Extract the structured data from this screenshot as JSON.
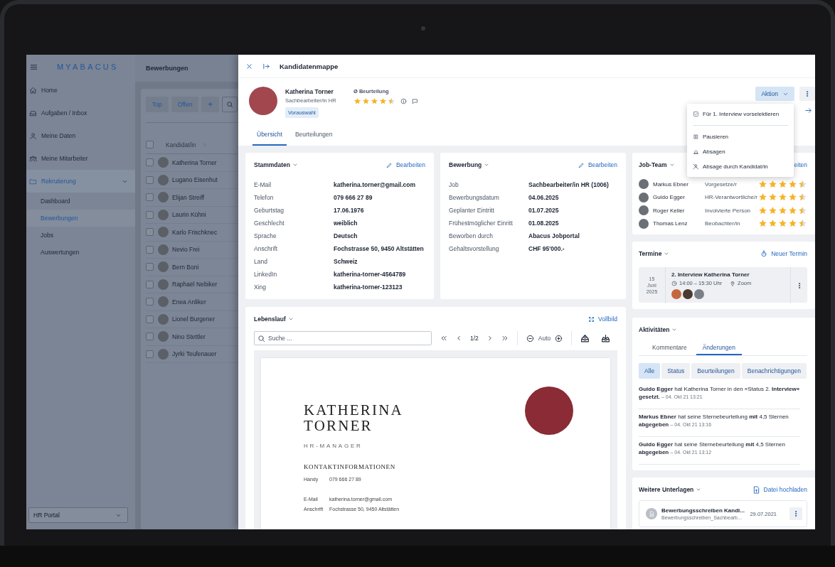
{
  "sidebar": {
    "logo": "MYABACUS",
    "items": [
      {
        "label": "Home",
        "selected": false
      },
      {
        "label": "Aufgaben / Inbox",
        "selected": false
      },
      {
        "label": "Meine Daten",
        "selected": false
      },
      {
        "label": "Meine Mitarbeiter",
        "selected": false
      },
      {
        "label": "Rekrutierung",
        "selected": true,
        "expanded": true,
        "children": [
          {
            "label": "Dashboard",
            "selected": false
          },
          {
            "label": "Bewerbungen",
            "selected": true
          },
          {
            "label": "Jobs",
            "selected": false
          },
          {
            "label": "Auswertungen",
            "selected": false
          }
        ]
      }
    ],
    "portal": {
      "value": "HR Portal"
    }
  },
  "list": {
    "title": "Bewerbungen",
    "filters": [
      "Top",
      "Offen"
    ],
    "add": "+",
    "column": "Kandidat/in",
    "select_all": {
      "checked": false
    },
    "rows": [
      {
        "name": "Katherina Torner",
        "checked": false
      },
      {
        "name": "Lugano Eisenhut",
        "checked": false
      },
      {
        "name": "Elijan Streiff",
        "checked": false
      },
      {
        "name": "Laurin Kühni",
        "checked": false
      },
      {
        "name": "Karlo Frischknec",
        "checked": false
      },
      {
        "name": "Nevio Frei",
        "checked": false
      },
      {
        "name": "Bern Boni",
        "checked": false
      },
      {
        "name": "Raphaël Nebiker",
        "checked": false
      },
      {
        "name": "Enea Anliker",
        "checked": false
      },
      {
        "name": "Lionel Burgener",
        "checked": false
      },
      {
        "name": "Nino Stettler",
        "checked": false
      },
      {
        "name": "Jyrki Teufenauer",
        "checked": false
      }
    ]
  },
  "drawer": {
    "title": "Kandidatenmappe",
    "candidate": {
      "name": "Katherina Torner",
      "role": "Sachbearbeiter/in HR",
      "status": "Vorauswahl",
      "rating_label": "Ø Beurteilung",
      "stars": 4.5
    },
    "action_button": "Aktion",
    "menu": [
      {
        "items": [
          "Für 1. Interview vorselektieren"
        ]
      },
      {
        "items": [
          "Pausieren",
          "Absagen",
          "Absage durch Kandidat/in"
        ]
      }
    ],
    "tabs": [
      {
        "label": "Übersicht",
        "selected": true
      },
      {
        "label": "Beurteilungen",
        "selected": false
      }
    ],
    "stammdaten": {
      "title": "Stammdaten",
      "action": "Bearbeiten",
      "fields": [
        {
          "label": "E-Mail",
          "value": "katherina.torner@gmail.com"
        },
        {
          "label": "Telefon",
          "value": "079 666 27 89"
        },
        {
          "label": "Geburtstag",
          "value": "17.06.1976"
        },
        {
          "label": "Geschlecht",
          "value": "weiblich"
        },
        {
          "label": "Sprache",
          "value": "Deutsch"
        },
        {
          "label": "Anschrift",
          "value": "Fochstrasse 50, 9450 Altstätten"
        },
        {
          "label": "Land",
          "value": "Schweiz"
        },
        {
          "label": "LinkedIn",
          "value": "katherina-torner-4564789"
        },
        {
          "label": "Xing",
          "value": "katherina-torner-123123"
        }
      ]
    },
    "bewerbung": {
      "title": "Bewerbung",
      "action": "Bearbeiten",
      "fields": [
        {
          "label": "Job",
          "value": "Sachbearbeiter/in HR (1006)"
        },
        {
          "label": "Bewerbungsdatum",
          "value": "04.06.2025"
        },
        {
          "label": "Geplanter Eintritt",
          "value": "01.07.2025"
        },
        {
          "label": "Frühestmöglicher Einritt",
          "value": "01.08.2025"
        },
        {
          "label": "Beworben durch",
          "value": "Abacus Jobportal"
        },
        {
          "label": "Gehaltsvorstellung",
          "value": "CHF 95'000.-"
        }
      ]
    },
    "lebenslauf": {
      "title": "Lebenslauf",
      "action": "Vollbild",
      "search": {
        "placeholder": "Suche ..."
      },
      "page": "1/2",
      "zoom": "Auto",
      "document": {
        "name_lines": [
          "KATHERINA",
          "TORNER"
        ],
        "subtitle": "HR-MANAGER",
        "section": "KONTAKTINFORMATIONEN",
        "contacts": [
          {
            "label": "Handy",
            "value": "079 666 27 89"
          },
          {
            "label": "E-Mail",
            "value": "katherina.torner@gmail.com"
          },
          {
            "label": "Anschrift",
            "value": "Fochstrasse 50, 9450 Altstätten"
          }
        ]
      }
    },
    "job_team": {
      "title": "Job-Team",
      "action": "eiten",
      "members": [
        {
          "name": "Markus Ebner",
          "role": "Vorgesetze/r",
          "stars": 4.5
        },
        {
          "name": "Guido Egger",
          "role": "HR-Verantwortliche/r",
          "stars": 4.5
        },
        {
          "name": "Roger Keller",
          "role": "Involvierte Person",
          "stars": 4.5
        },
        {
          "name": "Thomas Lenz",
          "role": "Beobachter/in",
          "stars": 4.5
        }
      ]
    },
    "termine": {
      "title": "Termine",
      "action": "Neuer Termin",
      "events": [
        {
          "day": "15",
          "month": "Juni",
          "year": "2025",
          "title": "2. Interview Katherina Torner",
          "time": "14:00 – 15:30 Uhr",
          "location": "Zoom"
        }
      ]
    },
    "aktivitaeten": {
      "title": "Aktivitäten",
      "tabs": [
        {
          "label": "Kommentare",
          "selected": false
        },
        {
          "label": "Änderungen",
          "selected": true
        }
      ],
      "filters": [
        {
          "label": "Alle",
          "selected": true
        },
        {
          "label": "Status",
          "selected": false
        },
        {
          "label": "Beurteilungen",
          "selected": false
        },
        {
          "label": "Benachrichtigungen",
          "selected": false
        }
      ],
      "entries": [
        {
          "text": "**Guido Egger** hat Katherina Torner in den «Status 2. **Interview» gesetzt.**",
          "time": "– 04. Okt 21 13:21"
        },
        {
          "text": "**Markus Ebner** hat seine Sternebeurteilung **mit** 4,5 Sternen **abgegeben**",
          "time": "– 04. Okt 21 13:16"
        },
        {
          "text": "**Guido Egger** hat seine Sternebeurteilung **mit** 4,5 Sternen **abgegeben**",
          "time": "– 04. Okt 21 13:12"
        }
      ]
    },
    "unterlagen": {
      "title": "Weitere Unterlagen",
      "action": "Datei hochladen",
      "files": [
        {
          "name": "Bewerbungsschreiben Kandi...",
          "file": "Bewerbungsschreiben_Sachbearb...",
          "date": "29.07.2021"
        }
      ]
    }
  }
}
